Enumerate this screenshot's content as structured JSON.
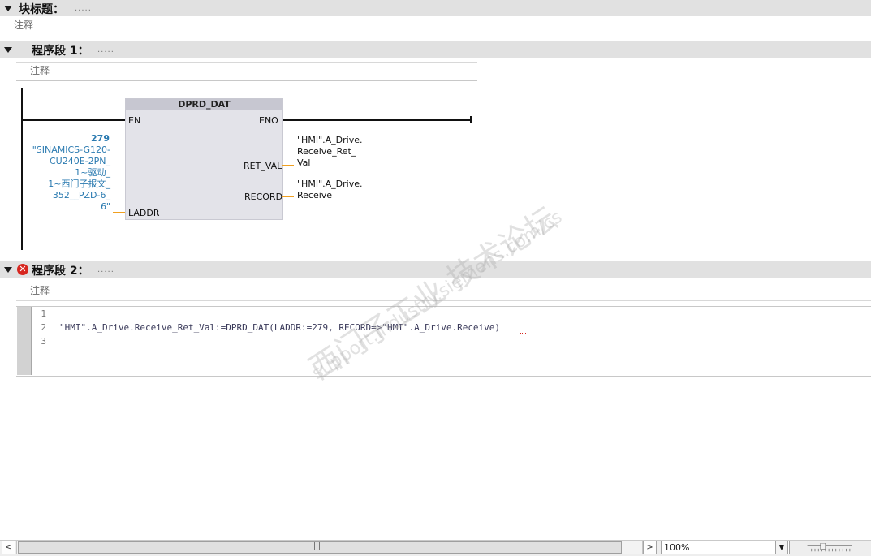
{
  "block": {
    "title": "块标题：",
    "dots": ".....",
    "comment": "注释"
  },
  "network1": {
    "title": "程序段 1：",
    "dots": ".....",
    "comment": "注释",
    "box": {
      "name": "DPRD_DAT",
      "pin_en": "EN",
      "pin_eno": "ENO",
      "pin_ret_val": "RET_VAL",
      "pin_record": "RECORD",
      "pin_laddr": "LADDR"
    },
    "laddr_const": "279",
    "laddr_tag": "\"SINAMICS-G120-\nCU240E-2PN_\n1~驱动_\n1~西门子报文_\n352__PZD-6_\n6\"",
    "ret_val_tag": "\"HMI\".A_Drive.\nReceive_Ret_\nVal",
    "record_tag": "\"HMI\".A_Drive.\nReceive"
  },
  "network2": {
    "title": "程序段 2：",
    "dots": ".....",
    "comment": "注释",
    "error_icon": "error-icon",
    "lines": [
      {
        "no": "1",
        "text": ""
      },
      {
        "no": "2",
        "text": "\"HMI\".A_Drive.Receive_Ret_Val:=DPRD_DAT(LADDR:=279, RECORD=>\"HMI\".A_Drive.Receive)"
      },
      {
        "no": "3",
        "text": ""
      }
    ]
  },
  "watermark": {
    "line1": "西门子工业  技术论坛",
    "line2": "support.industry.siemens.com/cs"
  },
  "bottom_bar": {
    "scroll_left": "<",
    "scroll_right": ">",
    "thumb_grip": "|||",
    "zoom": "100%",
    "zoom_dropdown": "▼"
  },
  "colors": {
    "accent_orange": "#f0a020",
    "tag_blue": "#2a7ab0",
    "error_red": "#d7261f"
  }
}
